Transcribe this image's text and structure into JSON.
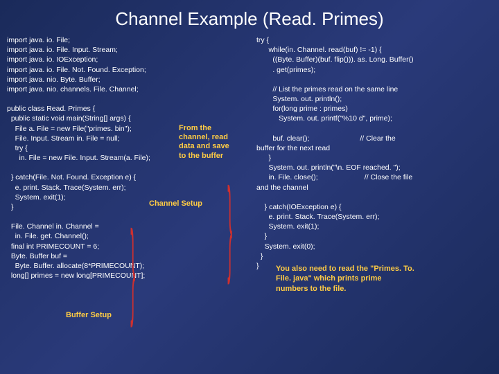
{
  "title": "Channel Example (Read. Primes)",
  "code_left": "import java. io. File;\nimport java. io. File. Input. Stream;\nimport java. io. IOException;\nimport java. io. File. Not. Found. Exception;\nimport java. nio. Byte. Buffer;\nimport java. nio. channels. File. Channel;\n\npublic class Read. Primes {\n  public static void main(String[] args) {\n    File a. File = new File(\"primes. bin\");\n    File. Input. Stream in. File = null;\n    try {\n      in. File = new File. Input. Stream(a. File);\n\n  } catch(File. Not. Found. Exception e) {\n    e. print. Stack. Trace(System. err);\n    System. exit(1);\n  }\n\n  File. Channel in. Channel =\n    in. File. get. Channel();\n  final int PRIMECOUNT = 6;\n  Byte. Buffer buf =\n    Byte. Buffer. allocate(8*PRIMECOUNT);\n  long[] primes = new long[PRIMECOUNT];",
  "code_right": "try {\n      while(in. Channel. read(buf) != -1) {\n        ((Byte. Buffer)(buf. flip())). as. Long. Buffer()\n        . get(primes);\n\n        // List the primes read on the same line\n        System. out. println();\n        for(long prime : primes)\n           System. out. printf(\"%10 d\", prime);\n\n        buf. clear();                         // Clear the\nbuffer for the next read\n      }\n      System. out. println(\"\\n. EOF reached. \");\n      in. File. close();                       // Close the file\nand the channel\n\n    } catch(IOException e) {\n      e. print. Stack. Trace(System. err);\n      System. exit(1);\n    }\n    System. exit(0);\n  }\n}",
  "annot_from": "From the\nchannel, read\ndata and save\nto the buffer",
  "annot_channel": "Channel Setup",
  "annot_buffer": "Buffer Setup",
  "note_text": "You also need to read the\n\"Primes. To. File. java\" which prints prime\nnumbers to the file."
}
